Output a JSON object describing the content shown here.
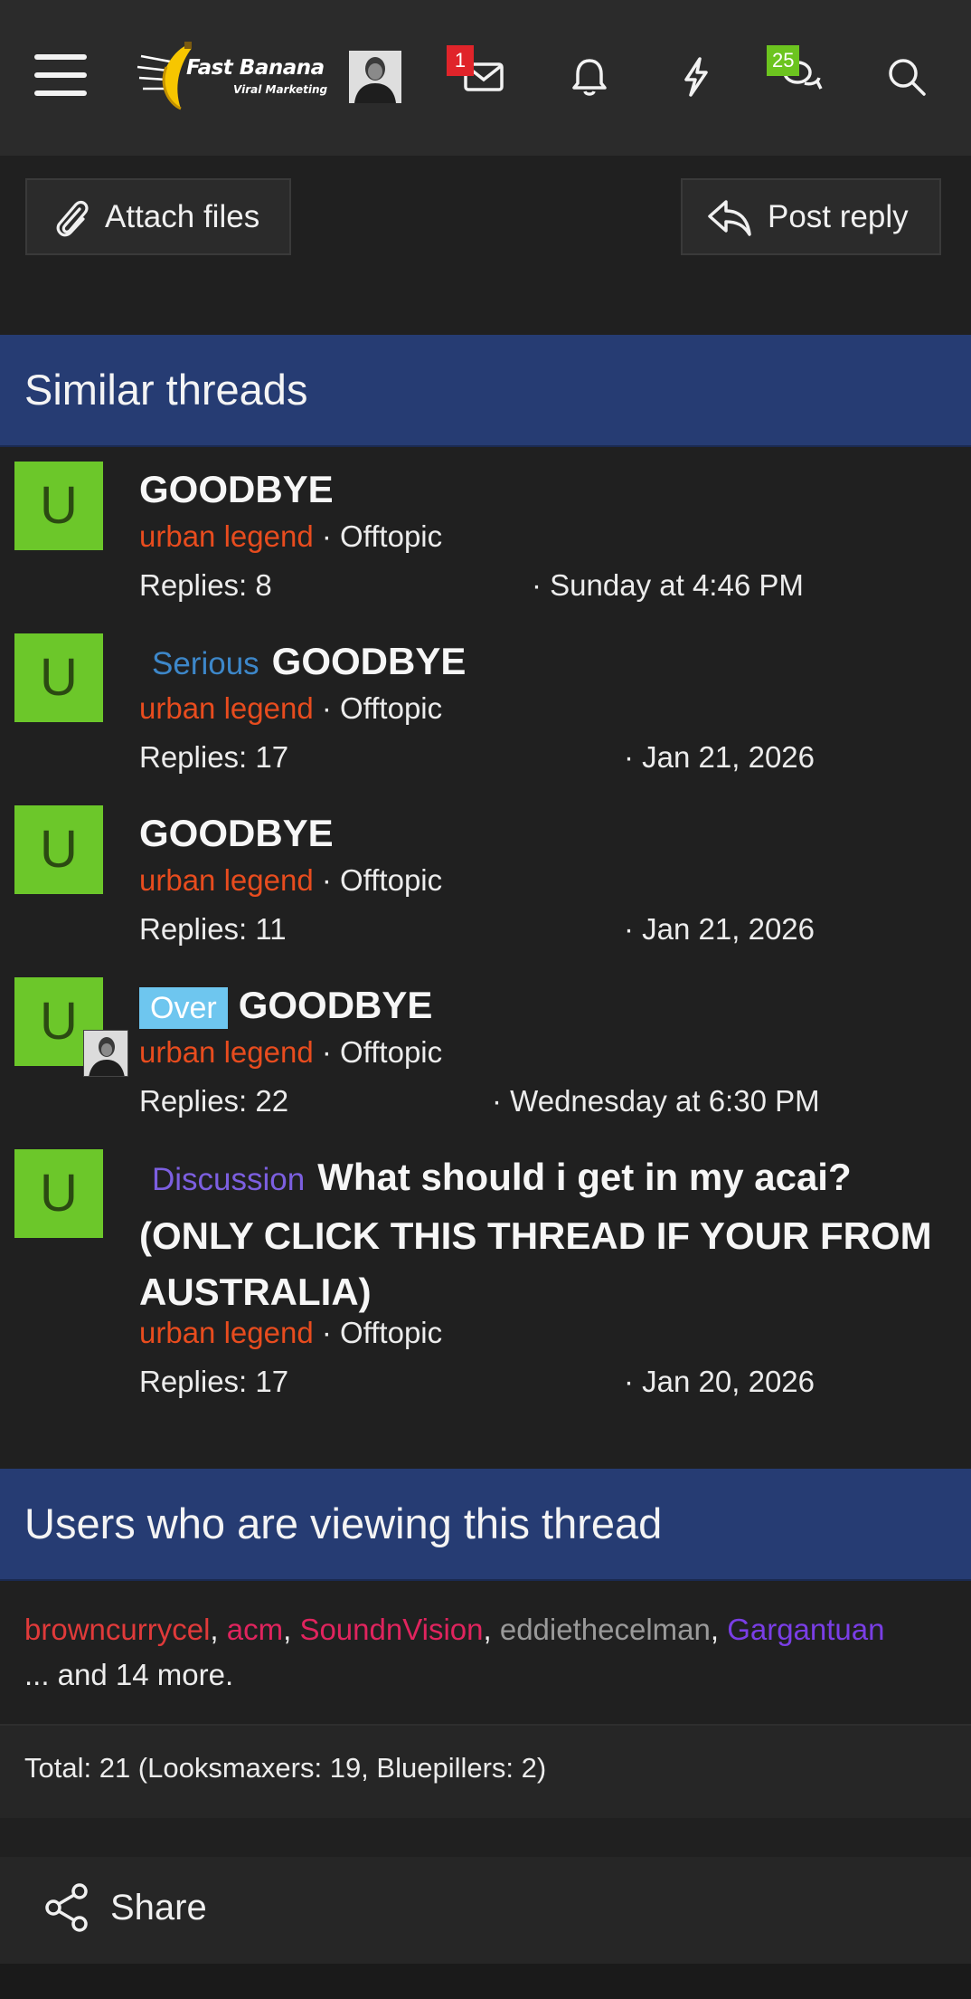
{
  "header": {
    "logo": {
      "name": "Fast Banana",
      "tagline": "Viral Marketing"
    },
    "inbox_badge": "1",
    "alerts_badge": "25",
    "icons": [
      "menu-icon",
      "envelope-icon",
      "bell-icon",
      "lightning-icon",
      "chat-bubbles-icon",
      "search-icon"
    ]
  },
  "actions": {
    "attach_label": "Attach files",
    "reply_label": "Post reply"
  },
  "similar": {
    "title": "Similar threads",
    "threads": [
      {
        "avatar": "U",
        "prefix": "",
        "title": "GOODBYE",
        "author": "urban legend",
        "forum": "Offtopic",
        "replies": "Replies: 8",
        "date": "Sunday at 4:46 PM"
      },
      {
        "avatar": "U",
        "prefix": "Serious",
        "title": "GOODBYE",
        "author": "urban legend",
        "forum": "Offtopic",
        "replies": "Replies: 17",
        "date": "Jan 21, 2026"
      },
      {
        "avatar": "U",
        "prefix": "",
        "title": "GOODBYE",
        "author": "urban legend",
        "forum": "Offtopic",
        "replies": "Replies: 11",
        "date": "Jan 21, 2026"
      },
      {
        "avatar": "U",
        "prefix": "Over",
        "title": "GOODBYE",
        "author": "urban legend",
        "forum": "Offtopic",
        "replies": "Replies: 22",
        "date": "Wednesday at 6:30 PM"
      },
      {
        "avatar": "U",
        "prefix": "Discussion",
        "title": "What should i get in my acai? (ONLY CLICK THIS THREAD IF YOUR FROM AUSTRALIA)",
        "author": "urban legend",
        "forum": "Offtopic",
        "replies": "Replies: 17",
        "date": "Jan 20, 2026"
      }
    ]
  },
  "viewing": {
    "title": "Users who are viewing this thread",
    "users": [
      "browncurrycel",
      "acm",
      "SoundnVision",
      "eddiethecelman",
      "Gargantuan"
    ],
    "more": "... and 14 more.",
    "totals": "Total: 21 (Looksmaxers: 19, Bluepillers: 2)"
  },
  "share": {
    "label": "Share"
  },
  "separators": {
    "comma": ",",
    "dot": "·"
  },
  "colors": {
    "section_header": "#263c73",
    "avatar_green": "#6cc72a",
    "username_orange": "#e84c1e",
    "badge_red": "#e0242a",
    "badge_green": "#6cc41f"
  }
}
